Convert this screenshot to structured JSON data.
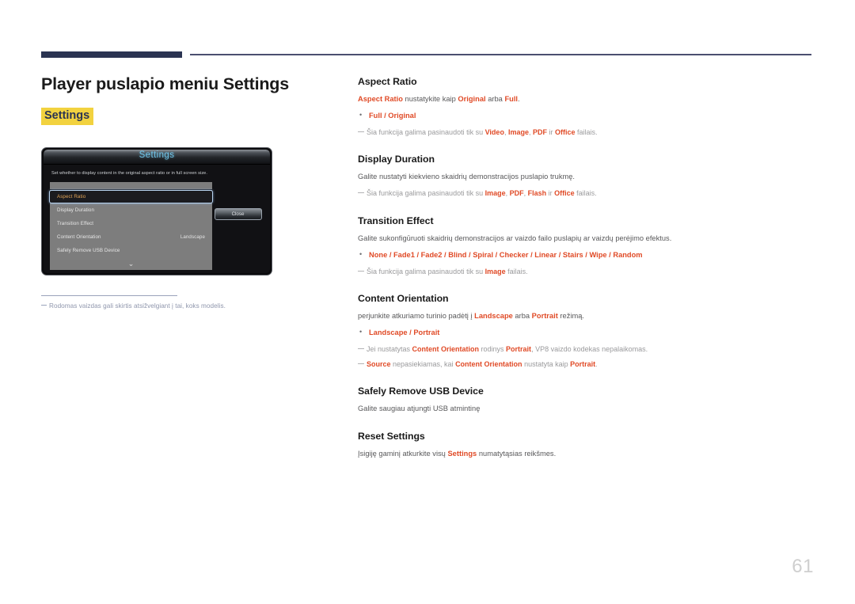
{
  "header": {
    "rule_color_thick": "#2b3452",
    "rule_color_thin": "#4b4f70"
  },
  "page_title": "Player puslapio meniu Settings",
  "settings_chip": {
    "label": "Settings",
    "bg": "#f2d23f",
    "fg": "#2b3452"
  },
  "tv_mock": {
    "title": "Settings",
    "description": "Set whether to display content in the original aspect ratio or in full screen size.",
    "rows": [
      {
        "label": "Aspect Ratio",
        "value": "",
        "selected": true
      },
      {
        "label": "Display Duration",
        "value": "",
        "selected": false
      },
      {
        "label": "Transition Effect",
        "value": "",
        "selected": false
      },
      {
        "label": "Content Orientation",
        "value": "Landscape",
        "selected": false
      },
      {
        "label": "Safely Remove USB Device",
        "value": "",
        "selected": false
      }
    ],
    "scroll_icon": "chevron-down-icon",
    "close_button": "Close"
  },
  "left_note": "Rodomas vaizdas gali skirtis atsižvelgiant į tai, koks modelis.",
  "sections": [
    {
      "heading": "Aspect Ratio",
      "body": [
        {
          "type": "text",
          "parts": [
            {
              "t": "Aspect Ratio",
              "em": true
            },
            {
              "t": " nustatykite kaip ",
              "em": false
            },
            {
              "t": "Original",
              "em": true
            },
            {
              "t": " arba ",
              "em": false
            },
            {
              "t": "Full",
              "em": true
            },
            {
              "t": ".",
              "em": false
            }
          ]
        },
        {
          "type": "bullet",
          "text": "Full / Original"
        },
        {
          "type": "note",
          "parts": [
            {
              "t": "Šia funkcija galima pasinaudoti tik su ",
              "em": false
            },
            {
              "t": "Video",
              "em": true
            },
            {
              "t": ", ",
              "em": false
            },
            {
              "t": "Image",
              "em": true
            },
            {
              "t": ", ",
              "em": false
            },
            {
              "t": "PDF",
              "em": true
            },
            {
              "t": " ir ",
              "em": false
            },
            {
              "t": "Office",
              "em": true
            },
            {
              "t": " failais.",
              "em": false
            }
          ]
        }
      ]
    },
    {
      "heading": "Display Duration",
      "body": [
        {
          "type": "text",
          "parts": [
            {
              "t": "Galite nustatyti kiekvieno skaidrių demonstracijos puslapio trukmę.",
              "em": false
            }
          ]
        },
        {
          "type": "note",
          "parts": [
            {
              "t": "Šia funkcija galima pasinaudoti tik su ",
              "em": false
            },
            {
              "t": "Image",
              "em": true
            },
            {
              "t": ", ",
              "em": false
            },
            {
              "t": "PDF",
              "em": true
            },
            {
              "t": ", ",
              "em": false
            },
            {
              "t": "Flash",
              "em": true
            },
            {
              "t": " ir ",
              "em": false
            },
            {
              "t": "Office",
              "em": true
            },
            {
              "t": " failais.",
              "em": false
            }
          ]
        }
      ]
    },
    {
      "heading": "Transition Effect",
      "body": [
        {
          "type": "text",
          "parts": [
            {
              "t": "Galite sukonfigūruoti skaidrių demonstracijos ar vaizdo failo puslapių ar vaizdų perėjimo efektus.",
              "em": false
            }
          ]
        },
        {
          "type": "bullet",
          "text": "None / Fade1 / Fade2 / Blind / Spiral / Checker / Linear / Stairs / Wipe / Random"
        },
        {
          "type": "note",
          "parts": [
            {
              "t": "Šia funkcija galima pasinaudoti tik su ",
              "em": false
            },
            {
              "t": "Image",
              "em": true
            },
            {
              "t": " failais.",
              "em": false
            }
          ]
        }
      ]
    },
    {
      "heading": "Content Orientation",
      "body": [
        {
          "type": "text",
          "parts": [
            {
              "t": "perjunkite atkuriamo turinio padėtį į ",
              "em": false
            },
            {
              "t": "Landscape",
              "em": true
            },
            {
              "t": " arba ",
              "em": false
            },
            {
              "t": "Portrait",
              "em": true
            },
            {
              "t": " režimą.",
              "em": false
            }
          ]
        },
        {
          "type": "bullet",
          "text": "Landscape / Portrait"
        },
        {
          "type": "note",
          "parts": [
            {
              "t": "Jei nustatytas ",
              "em": false
            },
            {
              "t": "Content Orientation",
              "em": true
            },
            {
              "t": " rodinys ",
              "em": false
            },
            {
              "t": "Portrait",
              "em": true
            },
            {
              "t": ", VP8 vaizdo kodekas nepalaikomas.",
              "em": false
            }
          ]
        },
        {
          "type": "note",
          "parts": [
            {
              "t": "Source",
              "em": true
            },
            {
              "t": " nepasiekiamas, kai ",
              "em": false
            },
            {
              "t": "Content Orientation",
              "em": true
            },
            {
              "t": " nustatyta kaip ",
              "em": false
            },
            {
              "t": "Portrait",
              "em": true
            },
            {
              "t": ".",
              "em": false
            }
          ]
        }
      ]
    },
    {
      "heading": "Safely Remove USB Device",
      "body": [
        {
          "type": "text",
          "parts": [
            {
              "t": "Galite saugiau atjungti USB atmintinę",
              "em": false
            }
          ]
        }
      ]
    },
    {
      "heading": "Reset Settings",
      "body": [
        {
          "type": "text",
          "parts": [
            {
              "t": "Įsigiję gaminį atkurkite visų ",
              "em": false
            },
            {
              "t": "Settings",
              "em": true
            },
            {
              "t": " numatytąsias reikšmes.",
              "em": false
            }
          ]
        }
      ]
    }
  ],
  "page_number": "61"
}
